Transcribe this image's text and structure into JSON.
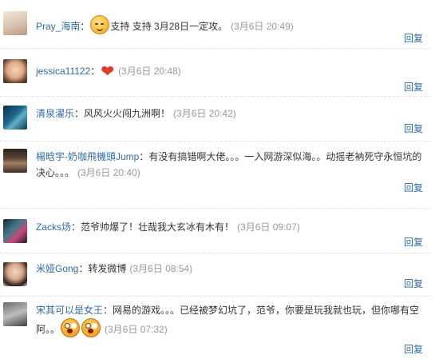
{
  "reply_label": "回复",
  "comments": [
    {
      "user": "Pray_海南",
      "sep": "：",
      "text_before": "",
      "text": "支持 支持 3月28日一定攻。",
      "time": "(3月6日 20:49)",
      "emoji": "sweat-face-icon",
      "avatar": "avatar-light"
    },
    {
      "user": "jessica11122",
      "sep": "：",
      "text": "",
      "time": "(3月6日 20:48)",
      "emoji": "heart-icon",
      "avatar": "avatar-girl"
    },
    {
      "user": "清泉濯乐",
      "sep": "：",
      "text": "风风火火闯九洲啊！",
      "time": "(3月6日 20:42)",
      "avatar": "avatar-blue"
    },
    {
      "user": "楊晗宇-奶咖飛機頭Jump",
      "sep": "：",
      "text": "有没有搞错啊大佬。。。一入网游深似海。。动摇老衲死守永恒坑的决心。。。",
      "time": "(3月6日 20:40)",
      "avatar": "avatar-dark"
    },
    {
      "user": "Zacks炀",
      "sep": "：",
      "text": "范爷帅爆了！壮哉我大玄冰有木有！",
      "time": "(3月6日 09:07)",
      "avatar": "avatar-cyan"
    },
    {
      "user": "米娅Gong",
      "sep": "：",
      "text": "转发微博",
      "time": "(3月6日 08:54)",
      "avatar": "avatar-woman"
    },
    {
      "user": "宋其可以是女王",
      "sep": "：",
      "text": "网易的游戏。。。已经被梦幻坑了，范爷，你要是玩我就也玩，但你哪有空阿。。",
      "time": "(3月6日 07:32)",
      "emoji": "scream-face-icon",
      "avatar": "avatar-gray"
    }
  ],
  "colors": {
    "link": "#2e6ba8",
    "text": "#333333",
    "time": "#999999"
  }
}
